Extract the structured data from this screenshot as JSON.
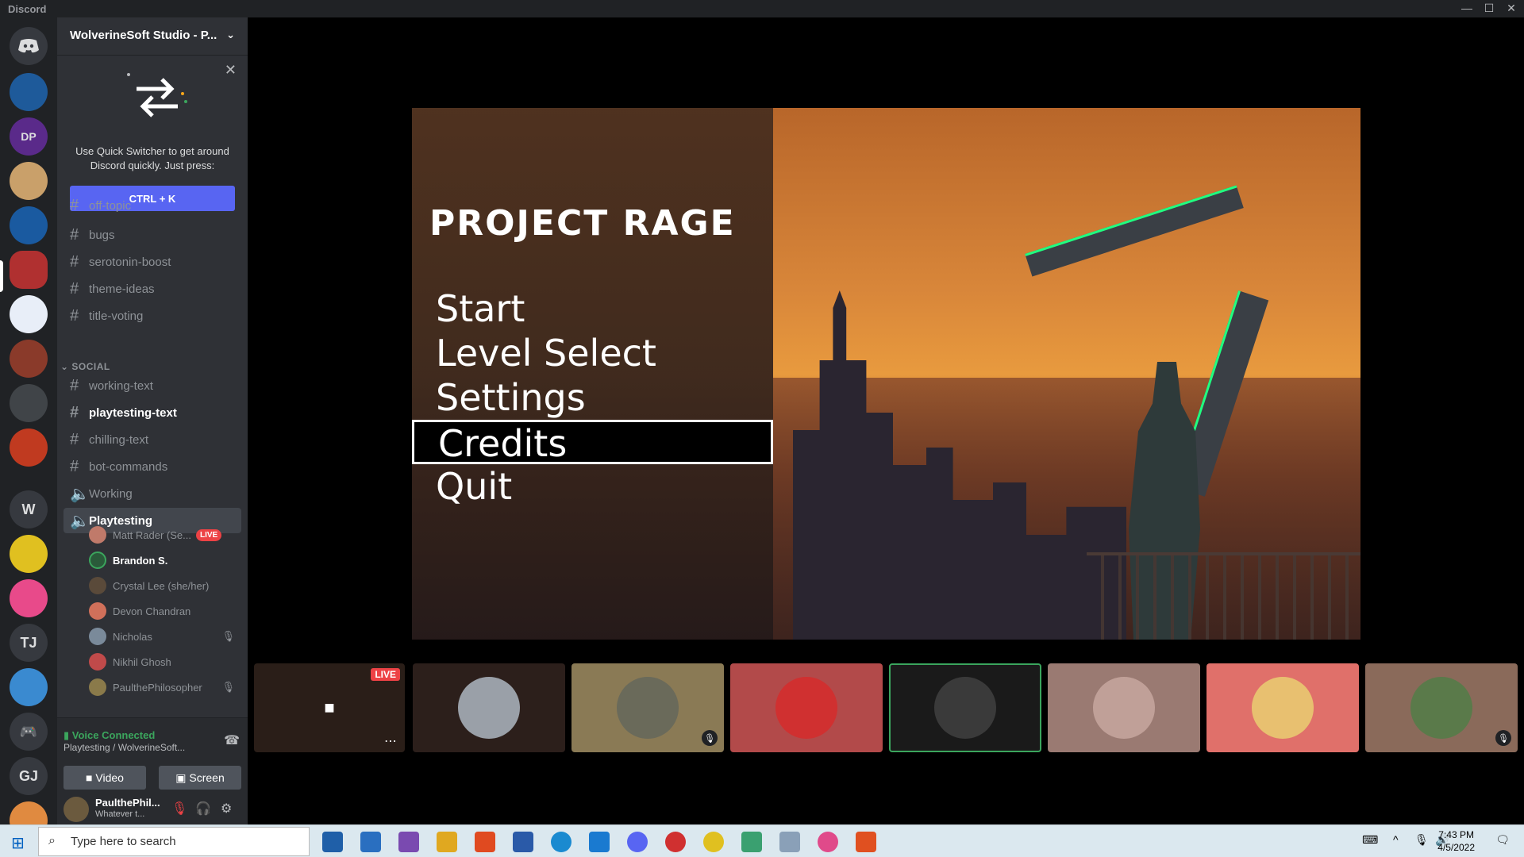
{
  "window": {
    "title": "Discord",
    "min": "—",
    "max": "☐",
    "close": "✕"
  },
  "server": {
    "name": "WolverineSoft Studio - P...",
    "chevron": "⌄"
  },
  "quick_switcher": {
    "close": "✕",
    "text": "Use Quick Switcher to get around Discord quickly. Just press:",
    "button": "CTRL + K"
  },
  "channels": {
    "top": [
      {
        "name": "off-topic"
      },
      {
        "name": "bugs"
      },
      {
        "name": "serotonin-boost"
      },
      {
        "name": "theme-ideas"
      },
      {
        "name": "title-voting"
      }
    ],
    "category": "SOCIAL",
    "social": [
      {
        "name": "working-text"
      },
      {
        "name": "playtesting-text"
      },
      {
        "name": "chilling-text"
      },
      {
        "name": "bot-commands"
      }
    ],
    "voice": [
      {
        "name": "Working"
      },
      {
        "name": "Playtesting"
      }
    ]
  },
  "voice_users": [
    {
      "name": "Matt Rader (Se...",
      "badge": "LIVE",
      "color": "#c07a6a"
    },
    {
      "name": "Brandon S.",
      "color": "#2a5a3a"
    },
    {
      "name": "Crystal Lee (she/her)",
      "color": "#5a4a3a"
    },
    {
      "name": "Devon Chandran",
      "color": "#d0705a"
    },
    {
      "name": "Nicholas",
      "color": "#7a8a9a",
      "muted": "🎙"
    },
    {
      "name": "Nikhil Ghosh",
      "color": "#c04a4a"
    },
    {
      "name": "PaulthePhilosopher",
      "color": "#8a7a4a",
      "muted": "🎙"
    }
  ],
  "voice_panel": {
    "status": "Voice Connected",
    "channel": "Playtesting / WolverineSoft...",
    "video": "Video",
    "screen": "Screen"
  },
  "user": {
    "name": "PaulthePhil...",
    "status": "Whatever t..."
  },
  "game": {
    "title": "PROJECT RAGE",
    "menu": [
      "Start",
      "Level Select",
      "Settings",
      "Credits",
      "Quit"
    ],
    "selected": "Credits"
  },
  "stream_tag": "LIVE",
  "participants": [
    {
      "bg": "#2c1f1b",
      "avatar": "#9aa0a8"
    },
    {
      "bg": "#8a7a55",
      "avatar": "#6a6a5a",
      "muted": true
    },
    {
      "bg": "#b24a4a",
      "avatar": "#d03030"
    },
    {
      "bg": "#1a1a1a",
      "avatar": "#3a3a3a",
      "speaking": true
    },
    {
      "bg": "#9a7a72",
      "avatar": "#c0a098"
    },
    {
      "bg": "#e0706a",
      "avatar": "#e8c070"
    },
    {
      "bg": "#8a6a5a",
      "avatar": "#5a7a4a",
      "muted": true
    }
  ],
  "guild_letters": [
    "W",
    "TJ",
    "GJ"
  ],
  "taskbar": {
    "search_placeholder": "Type here to search",
    "time": "7:43 PM",
    "date": "4/5/2022"
  },
  "colors": {
    "accent": "#5865f2",
    "green": "#3ba55d",
    "red": "#ed4245"
  }
}
